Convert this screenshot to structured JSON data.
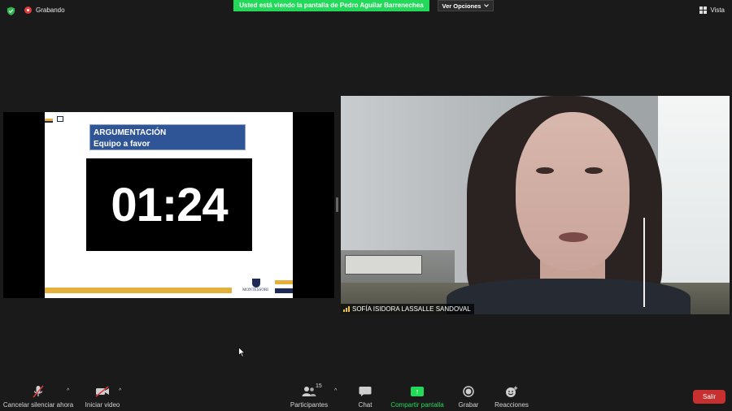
{
  "top_bar": {
    "recording_label": "Grabando",
    "share_banner": "Usted está viendo la pantalla de Pedro Aguilar Barrenechea",
    "view_options_label": "Ver Opciones",
    "view_label": "Vista"
  },
  "shared_slide": {
    "title_line1": "ARGUMENTACIÓN",
    "title_line2": "Equipo a favor",
    "timer": "01:24",
    "brand": "MONTESSORI"
  },
  "participant": {
    "name": "SOFÍA ISIDORA LASSALLE SANDOVAL"
  },
  "toolbar": {
    "mute_label": "Cancelar silenciar ahora",
    "video_label": "Iniciar video",
    "participants_label": "Participantes",
    "participants_count": "15",
    "chat_label": "Chat",
    "share_label": "Compartir pantalla",
    "record_label": "Grabar",
    "reactions_label": "Reacciones",
    "leave_label": "Salir"
  },
  "colors": {
    "share_green": "#23d959",
    "leave_red": "#c8302f",
    "slide_blue": "#2f5597",
    "slide_gold": "#e3b13b"
  }
}
